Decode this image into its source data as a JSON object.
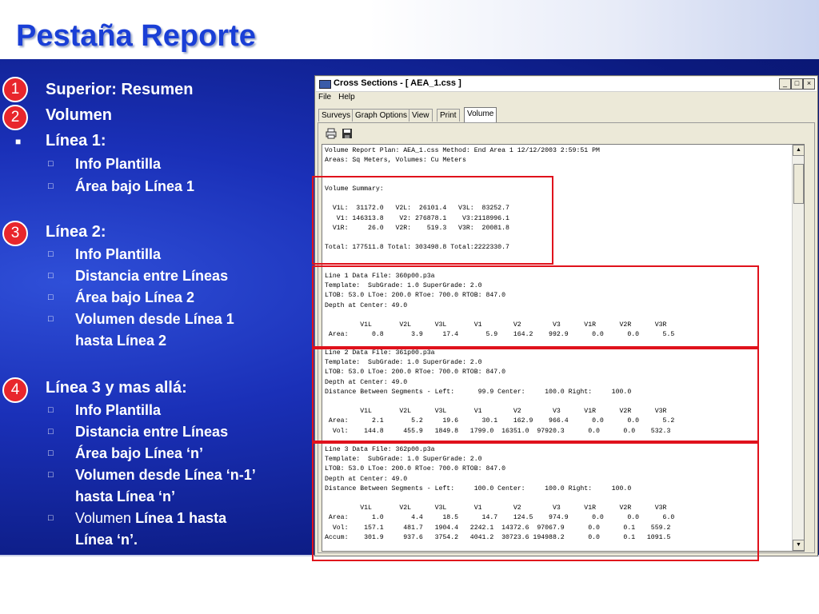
{
  "slide": {
    "title": "Pestaña Reporte"
  },
  "bullets": {
    "b_superior": "Superior:  Resumen",
    "b_volumen": "Volumen",
    "b_linea1": "Línea 1:",
    "b_linea1_sub1": "Info Plantilla",
    "b_linea1_sub2": "Área bajo Línea 1",
    "b_linea2": "Línea 2:",
    "b_linea2_sub1": "Info Plantilla",
    "b_linea2_sub2": "Distancia entre Líneas",
    "b_linea2_sub3": "Área bajo Línea 2",
    "b_linea2_sub4a": "Volumen desde Línea 1",
    "b_linea2_sub4b": "hasta Línea 2",
    "b_linea3": "Línea 3 y mas allá:",
    "b_linea3_sub1": "Info Plantilla",
    "b_linea3_sub2": "Distancia entre Líneas",
    "b_linea3_sub3": "Área bajo Línea ‘n’",
    "b_linea3_sub4a": "Volumen desde Línea ‘n-1’",
    "b_linea3_sub4b": "hasta Línea ‘n’",
    "b_linea3_sub5_normal": "Volumen ",
    "b_linea3_sub5_bold": "Línea 1 hasta",
    "b_linea3_sub5b": "Línea ‘n’."
  },
  "markers": [
    "1",
    "2",
    "3",
    "4"
  ],
  "window": {
    "title": "Cross  Sections - [ AEA_1.css ]",
    "menu": [
      "File",
      "Help"
    ],
    "tabs": [
      "Surveys",
      "Graph Options",
      "View",
      "Print",
      "Volume"
    ],
    "active_tab": "Volume",
    "toolbar_icons": [
      "printer-icon",
      "save-disk-icon"
    ]
  },
  "report": {
    "header": "Volume Report Plan: AEA_1.css Method: End Area 1 12/12/2003 2:59:51 PM\nAreas: Sq Meters, Volumes: Cu Meters",
    "summary": "Volume Summary:\n\n  V1L:  31172.0   V2L:  26101.4   V3L:  83252.7\n   V1: 146313.8    V2: 276878.1    V3:2118996.1\n  V1R:     26.0   V2R:    519.3   V3R:  20081.8\n\nTotal: 177511.8 Total: 303498.8 Total:2222330.7",
    "line1": "Line 1 Data File: 360p00.p3a\nTemplate:  SubGrade: 1.0 SuperGrade: 2.0\nLTOB: 53.0 LToe: 200.0 RToe: 700.0 RTOB: 847.0\nDepth at Center: 49.0\n\n         V1L       V2L      V3L       V1        V2        V3      V1R      V2R      V3R\n Area:      0.8       3.9     17.4       5.9    164.2    992.9      0.0      0.0      5.5",
    "line2": "Line 2 Data File: 361p00.p3a\nTemplate:  SubGrade: 1.0 SuperGrade: 2.0\nLTOB: 53.0 LToe: 200.0 RToe: 700.0 RTOB: 847.0\nDepth at Center: 49.0\nDistance Between Segments - Left:      99.9 Center:     100.0 Right:     100.0\n\n         V1L       V2L      V3L       V1        V2        V3      V1R      V2R      V3R\n Area:      2.1       5.2     19.6      30.1    162.9    966.4      0.0      0.0      5.2\n  Vol:    144.8     455.9   1849.8   1799.0  16351.0  97920.3      0.0      0.0    532.3",
    "line3": "Line 3 Data File: 362p00.p3a\nTemplate:  SubGrade: 1.0 SuperGrade: 2.0\nLTOB: 53.0 LToe: 200.0 RToe: 700.0 RTOB: 847.0\nDepth at Center: 49.0\nDistance Between Segments - Left:     100.0 Center:     100.0 Right:     100.0\n\n         V1L       V2L      V3L       V1        V2        V3      V1R      V2R      V3R\n Area:      1.0       4.4     18.5      14.7    124.5    974.9      0.0      0.0      6.0\n  Vol:    157.1     481.7   1904.4   2242.1  14372.6  97067.9      0.0      0.1    559.2\nAccum:    301.9     937.6   3754.2   4041.2  30723.6 194988.2      0.0      0.1   1091.5"
  },
  "colors": {
    "title": "#1a3fd6",
    "panel": "#0b1a7e",
    "marker": "#e8262c",
    "highlight_box": "#e0121c"
  }
}
